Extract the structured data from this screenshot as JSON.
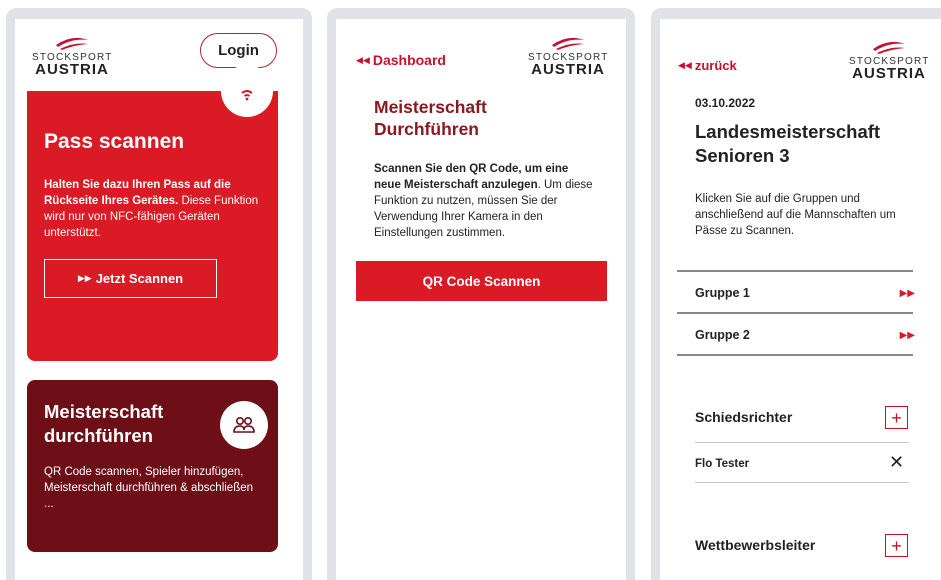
{
  "brand": {
    "line1": "STOCKSPORT",
    "line2": "AUSTRIA",
    "accent": "#da1a25",
    "dark": "#6e0f17"
  },
  "screen1": {
    "login_label": "Login",
    "pass_card": {
      "title": "Pass scannen",
      "text_bold": "Halten Sie dazu Ihren Pass auf die Rückseite Ihres Gerätes.",
      "text_rest": " Diese Funktion wird nur von NFC-fähigen Geräten unterstützt.",
      "button_icon": "▶▶",
      "button_label": "Jetzt Scannen",
      "icon": "nfc-icon"
    },
    "meister_card": {
      "title_line1": "Meisterschaft",
      "title_line2": "durchführen",
      "text": "QR Code scannen, Spieler hinzufügen, Meisterschaft durchführen & abschließen",
      "ellipsis": "...",
      "icon": "people-icon"
    }
  },
  "screen2": {
    "back_icon": "◀◀",
    "back_label": "Dashboard",
    "title_line1": "Meisterschaft",
    "title_line2": "Durchführen",
    "text_bold": "Scannen Sie den QR Code, um eine neue Meisterschaft anzulegen",
    "text_rest": ". Um diese Funktion zu nutzen, müssen Sie der Verwendung Ihrer Kamera in den Einstellungen zustimmen.",
    "qr_button": "QR Code Scannen"
  },
  "screen3": {
    "back_icon": "◀◀",
    "back_label": "zurück",
    "date": "03.10.2022",
    "title_line1": "Landesmeisterschaft",
    "title_line2": "Senioren 3",
    "text": "Klicken Sie auf die Gruppen und anschließend auf die Mannschaften um Pässe zu Scannen.",
    "groups": [
      {
        "label": "Gruppe 1",
        "arrow": "▶▶"
      },
      {
        "label": "Gruppe 2",
        "arrow": "▶▶"
      }
    ],
    "referee_label": "Schiedsrichter",
    "referee_name": "Flo Tester",
    "remove_icon": "✕",
    "plus_icon": "+",
    "competition_label": "Wettbewerbsleiter"
  }
}
